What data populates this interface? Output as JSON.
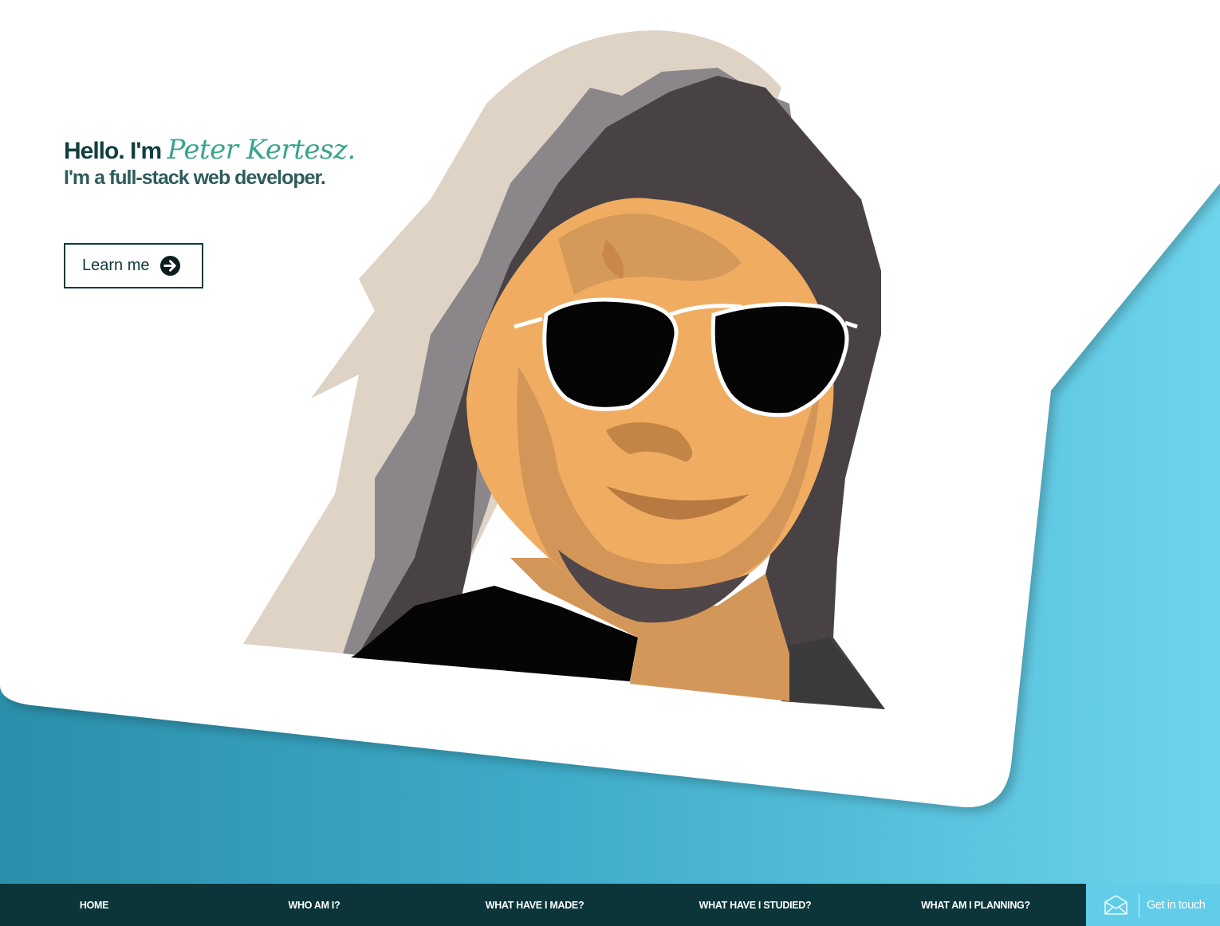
{
  "hero": {
    "greeting": "Hello. I'm",
    "name": "Peter Kertesz.",
    "tagline": "I'm a full-stack web developer.",
    "cta_label": "Learn me",
    "cta_icon": "arrow-circle-right-icon",
    "portrait_alt": "Illustrated portrait with sunglasses"
  },
  "nav": {
    "items": [
      {
        "label": "HOME"
      },
      {
        "label": "WHO AM I?"
      },
      {
        "label": "WHAT HAVE I MADE?"
      },
      {
        "label": "WHAT HAVE I STUDIED?"
      },
      {
        "label": "WHAT AM I PLANNING?"
      }
    ],
    "contact_label": "Get in touch",
    "contact_icon": "envelope-icon"
  },
  "colors": {
    "nav_bg": "#0b3538",
    "contact_bg": "#62cde8",
    "accent": "#3aa38f",
    "hero_gradient_start": "#2a8faa",
    "hero_gradient_end": "#6dd4ec"
  }
}
